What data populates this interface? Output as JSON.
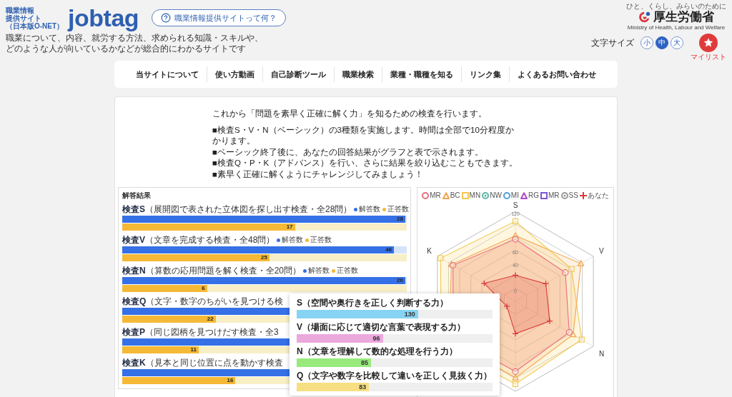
{
  "header": {
    "logo": {
      "caption": [
        "職業情報",
        "提供サイト",
        "（日本版O-NET）"
      ],
      "wordmark": "jobtag"
    },
    "about_button": "職業情報提供サイトって何？",
    "tagline": [
      "職業について、内容、就労する方法、求められる知識・スキルや、",
      "どのような人が向いているかなどが総合的にわかるサイトです"
    ],
    "ministry": {
      "motto": "ひと、くらし、みらいのために",
      "name": "厚生労働省",
      "english": "Ministry of Health, Labour and Welfare"
    },
    "font_size": {
      "label": "文字サイズ",
      "options": [
        {
          "label": "小",
          "selected": false
        },
        {
          "label": "中",
          "selected": true
        },
        {
          "label": "大",
          "selected": false
        }
      ]
    },
    "mylist": "マイリスト"
  },
  "nav": [
    "当サイトについて",
    "使い方動画",
    "自己診断ツール",
    "職業検索",
    "業種・職種を知る",
    "リンク集",
    "よくあるお問い合わせ"
  ],
  "intro": {
    "lead": "これから「問題を素早く正確に解く力」を知るための検査を行います。",
    "notes": [
      "■検査S・V・N（ベーシック）の3種類を実施します。時間は全部で10分程度かかります。",
      "■ベーシック終了後に、あなたの回答結果がグラフと表で示されます。",
      "■検査Q・P・K（アドバンス）を行い、さらに結果を絞り込むこともできます。",
      "■素早く正確に解くようにチャレンジしてみましょう！"
    ]
  },
  "results": {
    "title": "解答結果",
    "groups": [
      {
        "name": "検査S",
        "description": "（展開図で表された立体図を探し出す検査・全28問）",
        "legend": [
          {
            "label": "解答数",
            "color": "#3570e6"
          },
          {
            "label": "正答数",
            "color": "#f5b935"
          }
        ],
        "bars": [
          {
            "kind": "answered",
            "level": 1,
            "value": "28"
          },
          {
            "kind": "correct",
            "level": 0.61,
            "value": "17"
          }
        ]
      },
      {
        "name": "検査V",
        "description": "（文章を完成する検査・全48問）",
        "legend": [
          {
            "label": "解答数",
            "color": "#3570e6"
          },
          {
            "label": "正答数",
            "color": "#f5b935"
          }
        ],
        "bars": [
          {
            "kind": "answered",
            "level": 0.96,
            "value": "46"
          },
          {
            "kind": "correct",
            "level": 0.52,
            "value": "25"
          }
        ]
      },
      {
        "name": "検査N",
        "description": "（算数の応用問題を解く検査・全20問）",
        "legend": [
          {
            "label": "解答数",
            "color": "#3570e6"
          },
          {
            "label": "正答数",
            "color": "#f5b935"
          }
        ],
        "bars": [
          {
            "kind": "answered",
            "level": 1,
            "value": "20"
          },
          {
            "kind": "correct",
            "level": 0.3,
            "value": "6"
          }
        ]
      },
      {
        "name": "検査Q",
        "description": "（文字・数字のちがいを見つける検",
        "bars": [
          {
            "kind": "answered",
            "level": 1
          },
          {
            "kind": "correct",
            "level": 0.33,
            "value": "22"
          }
        ]
      },
      {
        "name": "検査P",
        "description": "（同じ図柄を見つけだす検査・全3",
        "bars": [
          {
            "kind": "answered",
            "level": 1
          },
          {
            "kind": "correct",
            "level": 0.27,
            "value": "11"
          }
        ]
      },
      {
        "name": "検査K",
        "description": "（見本と同じ位置に点を動かす検査",
        "bars": [
          {
            "kind": "answered",
            "level": 1
          },
          {
            "kind": "correct",
            "level": 0.4,
            "value": "16"
          }
        ]
      }
    ]
  },
  "radar_chart": {
    "legend": [
      {
        "label": "MR",
        "kind": "circle",
        "color": "#e8707c"
      },
      {
        "label": "BC",
        "kind": "triangle",
        "color": "#f2a54a"
      },
      {
        "label": "MN",
        "kind": "square",
        "color": "#f0c850"
      },
      {
        "label": "NW",
        "kind": "ring",
        "color": "#5bb5a8"
      },
      {
        "label": "MI",
        "kind": "circle",
        "color": "#4a9fe0"
      },
      {
        "label": "RG",
        "kind": "triangle",
        "color": "#b04ad0"
      },
      {
        "label": "MR",
        "kind": "square",
        "color": "#7b55d6"
      },
      {
        "label": "SS",
        "kind": "ring",
        "color": "#9a9a9a"
      },
      {
        "label": "あなた",
        "kind": "cross",
        "color": "#d93a3a"
      }
    ],
    "axes": [
      "S",
      "V",
      "N",
      "K"
    ],
    "ticks": [
      "120",
      "60",
      "40",
      "0"
    ]
  },
  "ability_card": {
    "rows": [
      {
        "label": "S（空間や奥行きを正しく判断する力）",
        "level": 0.62,
        "value": "130",
        "color": "#86d3f3"
      },
      {
        "label": "V（場面に応じて適切な言葉で表現する力）",
        "level": 0.44,
        "value": "96",
        "color": "#eba8dc"
      },
      {
        "label": "N（文章を理解して数的な処理を行う力）",
        "level": 0.38,
        "value": "85",
        "color": "#98ea7c"
      },
      {
        "label": "Q（文字や数字を比較して違いを正しく見抜く力）",
        "level": 0.37,
        "value": "83",
        "color": "#f6df82"
      }
    ]
  }
}
